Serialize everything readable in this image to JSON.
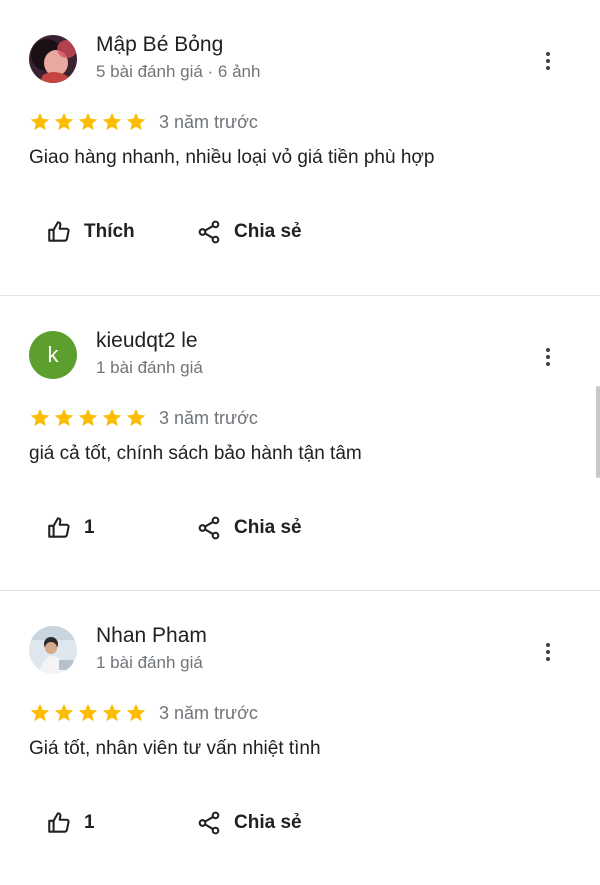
{
  "reviews": [
    {
      "author": "Mập Bé Bỏng",
      "meta": "5 bài đánh giá · 6 ảnh",
      "avatar": {
        "type": "photo",
        "icon": "user-photo-avatar"
      },
      "rating": 5,
      "time": "3 năm trước",
      "text": "Giao hàng nhanh, nhiều loại vỏ giá tiền phù hợp",
      "like_label": "Thích",
      "share_label": "Chia sẻ"
    },
    {
      "author": "kieudqt2 le",
      "meta": "1 bài đánh giá",
      "avatar": {
        "type": "letter",
        "letter": "k",
        "color": "#5c9f2e"
      },
      "rating": 5,
      "time": "3 năm trước",
      "text": "giá cả tốt, chính sách bảo hành tận tâm",
      "like_label": "1",
      "share_label": "Chia sẻ"
    },
    {
      "author": "Nhan Pham",
      "meta": "1 bài đánh giá",
      "avatar": {
        "type": "photo",
        "icon": "user-photo-avatar"
      },
      "rating": 5,
      "time": "3 năm trước",
      "text": "Giá tốt, nhân viên tư vấn nhiệt tình",
      "like_label": "1",
      "share_label": "Chia sẻ"
    }
  ],
  "colors": {
    "star": "#fbbc04",
    "secondary_text": "#70757a"
  }
}
